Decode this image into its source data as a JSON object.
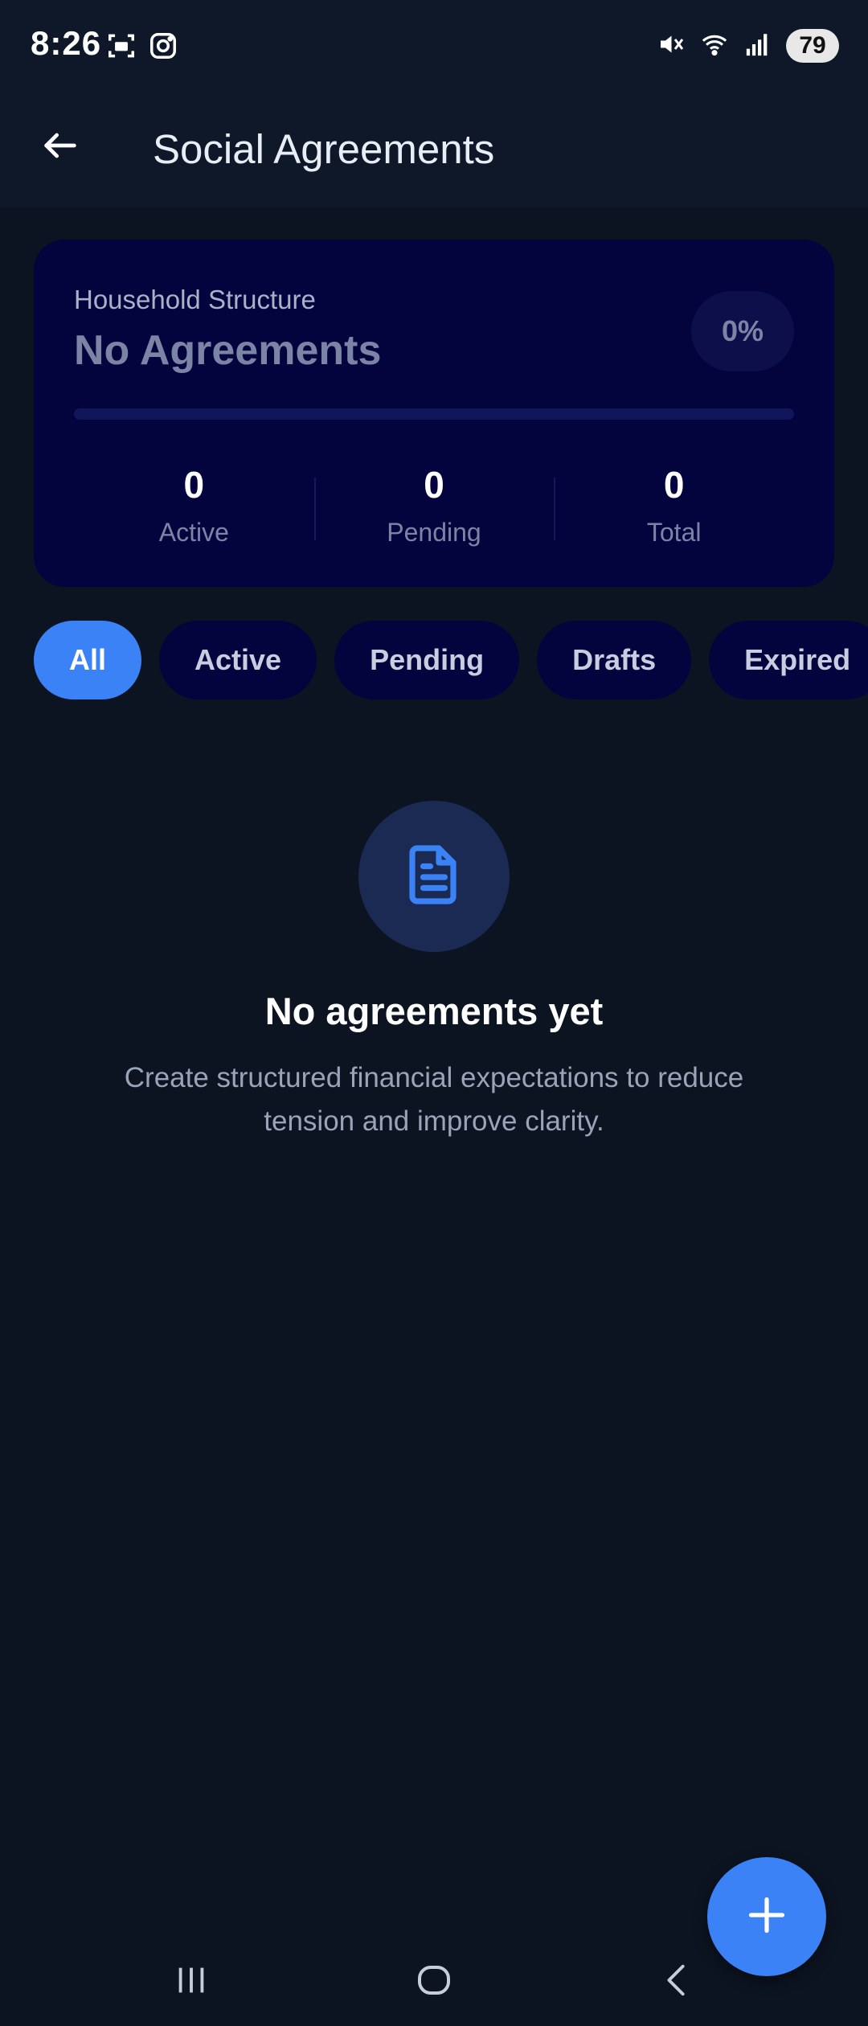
{
  "status_bar": {
    "time": "8:26",
    "battery": "79",
    "icons": [
      "screenshot-icon",
      "instagram-icon",
      "mute-icon",
      "wifi-icon",
      "signal-icon"
    ]
  },
  "app_bar": {
    "title": "Social Agreements"
  },
  "summary": {
    "label": "Household Structure",
    "status": "No Agreements",
    "percent": "0%",
    "progress_fraction": 0,
    "stats": [
      {
        "value": "0",
        "label": "Active"
      },
      {
        "value": "0",
        "label": "Pending"
      },
      {
        "value": "0",
        "label": "Total"
      }
    ]
  },
  "filters": [
    {
      "label": "All",
      "selected": true
    },
    {
      "label": "Active",
      "selected": false
    },
    {
      "label": "Pending",
      "selected": false
    },
    {
      "label": "Drafts",
      "selected": false
    },
    {
      "label": "Expired",
      "selected": false
    }
  ],
  "empty_state": {
    "icon": "document-icon",
    "title": "No agreements yet",
    "subtitle": "Create structured financial expectations to reduce tension and improve clarity."
  },
  "colors": {
    "accent": "#3b82f6",
    "background": "#0c1421",
    "card": "#03033d"
  }
}
